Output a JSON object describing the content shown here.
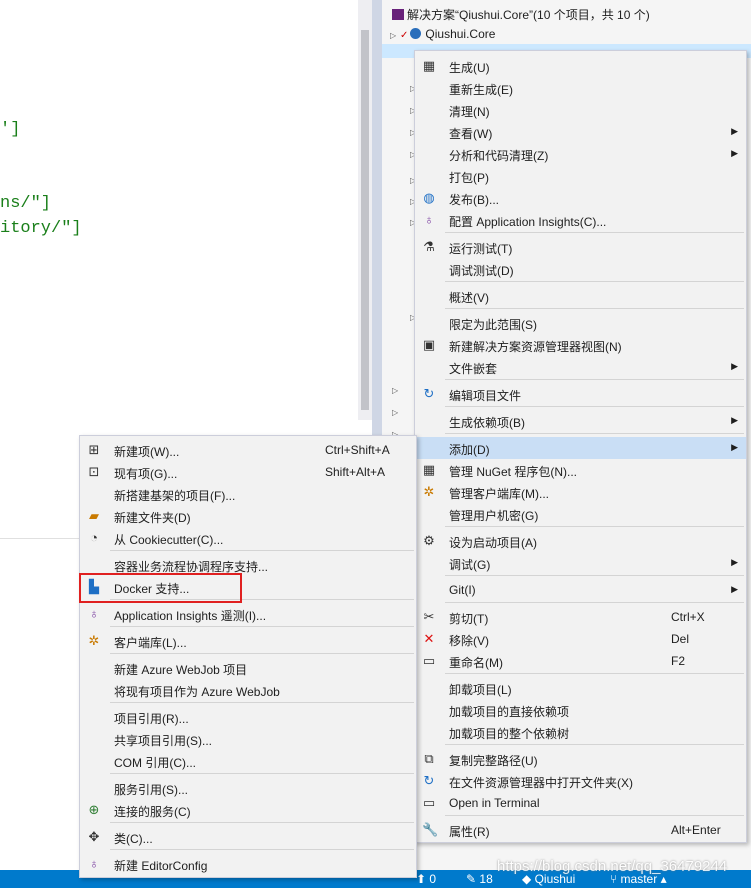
{
  "editor": {
    "code_lines": [
      "']",
      "ns/\"]",
      "itory/\"]"
    ]
  },
  "solution_explorer": {
    "solution_label": "解决方案“Qiushui.Core”(10 个项目，共 10 个)",
    "project_core": "Qiushui.Core"
  },
  "main_menu": {
    "items": [
      {
        "label": "生成(U)",
        "icon": "build-icon"
      },
      {
        "label": "重新生成(E)"
      },
      {
        "label": "清理(N)"
      },
      {
        "label": "查看(W)",
        "submenu": true
      },
      {
        "label": "分析和代码清理(Z)",
        "submenu": true
      },
      {
        "label": "打包(P)"
      },
      {
        "label": "发布(B)...",
        "icon": "globe-icon"
      },
      {
        "label": "配置 Application Insights(C)...",
        "icon": "bulb-icon"
      },
      {
        "label": "运行测试(T)",
        "icon": "flask-icon"
      },
      {
        "label": "调试测试(D)"
      },
      {
        "label": "概述(V)"
      },
      {
        "label": "限定为此范围(S)"
      },
      {
        "label": "新建解决方案资源管理器视图(N)",
        "icon": "new-view-icon"
      },
      {
        "label": "文件嵌套",
        "submenu": true
      },
      {
        "label": "编辑项目文件",
        "icon": "refresh-icon"
      },
      {
        "label": "生成依赖项(B)",
        "submenu": true
      },
      {
        "label": "添加(D)",
        "submenu": true,
        "highlight": true
      },
      {
        "label": "管理 NuGet 程序包(N)...",
        "icon": "nuget-icon"
      },
      {
        "label": "管理客户端库(M)...",
        "icon": "client-lib-icon"
      },
      {
        "label": "管理用户机密(G)"
      },
      {
        "label": "设为启动项目(A)",
        "icon": "gear-icon"
      },
      {
        "label": "调试(G)",
        "submenu": true
      },
      {
        "label": "Git(I)",
        "submenu": true
      },
      {
        "label": "剪切(T)",
        "shortcut": "Ctrl+X",
        "icon": "scissors-icon"
      },
      {
        "label": "移除(V)",
        "shortcut": "Del",
        "icon": "remove-icon"
      },
      {
        "label": "重命名(M)",
        "shortcut": "F2",
        "icon": "rename-icon"
      },
      {
        "label": "卸载项目(L)"
      },
      {
        "label": "加载项目的直接依赖项"
      },
      {
        "label": "加载项目的整个依赖树"
      },
      {
        "label": "复制完整路径(U)",
        "icon": "copy-icon"
      },
      {
        "label": "在文件资源管理器中打开文件夹(X)",
        "icon": "open-folder-icon"
      },
      {
        "label": "Open in Terminal",
        "icon": "terminal-icon"
      },
      {
        "label": "属性(R)",
        "shortcut": "Alt+Enter",
        "icon": "wrench-icon"
      }
    ]
  },
  "add_submenu": {
    "items": [
      {
        "label": "新建项(W)...",
        "shortcut": "Ctrl+Shift+A",
        "icon": "new-item-icon"
      },
      {
        "label": "现有项(G)...",
        "shortcut": "Shift+Alt+A",
        "icon": "existing-item-icon"
      },
      {
        "label": "新搭建基架的项目(F)..."
      },
      {
        "label": "新建文件夹(D)",
        "icon": "new-folder-icon"
      },
      {
        "label": "从 Cookiecutter(C)...",
        "icon": "cookie-icon"
      },
      {
        "label": "容器业务流程协调程序支持..."
      },
      {
        "label": "Docker 支持...",
        "icon": "docker-icon"
      },
      {
        "label": "Application Insights 遥测(I)...",
        "icon": "bulb-icon"
      },
      {
        "label": "客户端库(L)...",
        "icon": "client-lib-icon"
      },
      {
        "label": "新建 Azure WebJob 项目"
      },
      {
        "label": "将现有项目作为 Azure WebJob"
      },
      {
        "label": "项目引用(R)..."
      },
      {
        "label": "共享项目引用(S)..."
      },
      {
        "label": "COM 引用(C)..."
      },
      {
        "label": "服务引用(S)..."
      },
      {
        "label": "连接的服务(C)",
        "icon": "connected-service-icon"
      },
      {
        "label": "类(C)...",
        "icon": "class-icon"
      },
      {
        "label": "新建 EditorConfig",
        "icon": "editorconfig-icon"
      }
    ]
  },
  "status_bar": {
    "errors": "0",
    "edits": "18",
    "repo": "Qiushui",
    "branch": "master"
  },
  "watermark": "https://blog.csdn.net/qq_36479244"
}
